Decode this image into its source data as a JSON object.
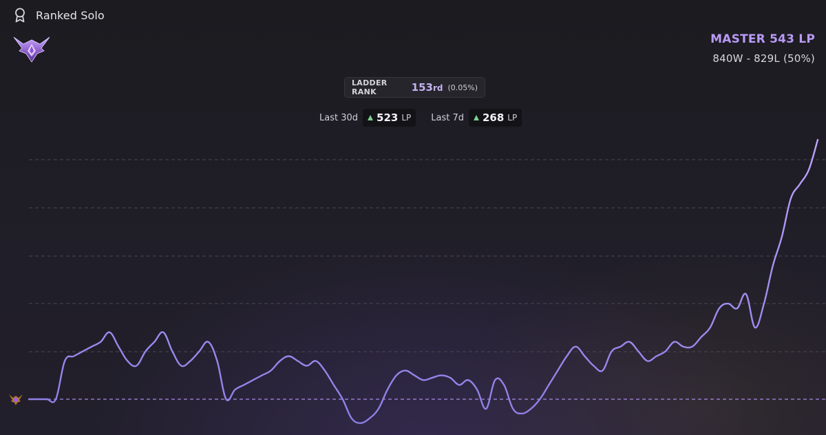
{
  "header": {
    "icon": "ribbon-award-icon",
    "title": "Ranked Solo"
  },
  "rank": {
    "tier_text": "MASTER 543 LP",
    "record_text": "840W - 829L (50%)",
    "emblem_icon": "master-tier-emblem-icon",
    "accent_color": "#b99af6"
  },
  "ladder": {
    "label": "LADDER RANK",
    "number": "153",
    "suffix": "rd",
    "percent": "(0.05%)"
  },
  "lp_changes": [
    {
      "period": "Last 30d",
      "value": "523",
      "unit": "LP",
      "trend_icon": "up-triangle-icon",
      "trend_color": "#7fd08f"
    },
    {
      "period": "Last 7d",
      "value": "268",
      "unit": "LP",
      "trend_icon": "up-triangle-icon",
      "trend_color": "#7fd08f"
    }
  ],
  "chart_data": {
    "type": "line",
    "title": "",
    "xlabel": "",
    "ylabel": "",
    "ylim": [
      -60,
      543
    ],
    "grid": "horizontal dashed",
    "baseline_icon": "master-tier-mini-icon",
    "line_color": "#a98be8",
    "series": [
      {
        "values": [
          0,
          0,
          0,
          0,
          80,
          90,
          100,
          110,
          120,
          140,
          110,
          80,
          70,
          100,
          120,
          140,
          100,
          70,
          80,
          100,
          120,
          80,
          0,
          20,
          30,
          40,
          50,
          60,
          80,
          90,
          80,
          70,
          80,
          60,
          30,
          0,
          -40,
          -50,
          -40,
          -20,
          20,
          50,
          60,
          50,
          40,
          45,
          50,
          45,
          30,
          40,
          20,
          -20,
          40,
          30,
          -20,
          -30,
          -20,
          0,
          30,
          60,
          90,
          110,
          90,
          70,
          60,
          100,
          110,
          120,
          100,
          80,
          90,
          100,
          120,
          110,
          110,
          130,
          150,
          190,
          200,
          190,
          220,
          150,
          200,
          280,
          340,
          420,
          450,
          480,
          543
        ]
      }
    ]
  }
}
